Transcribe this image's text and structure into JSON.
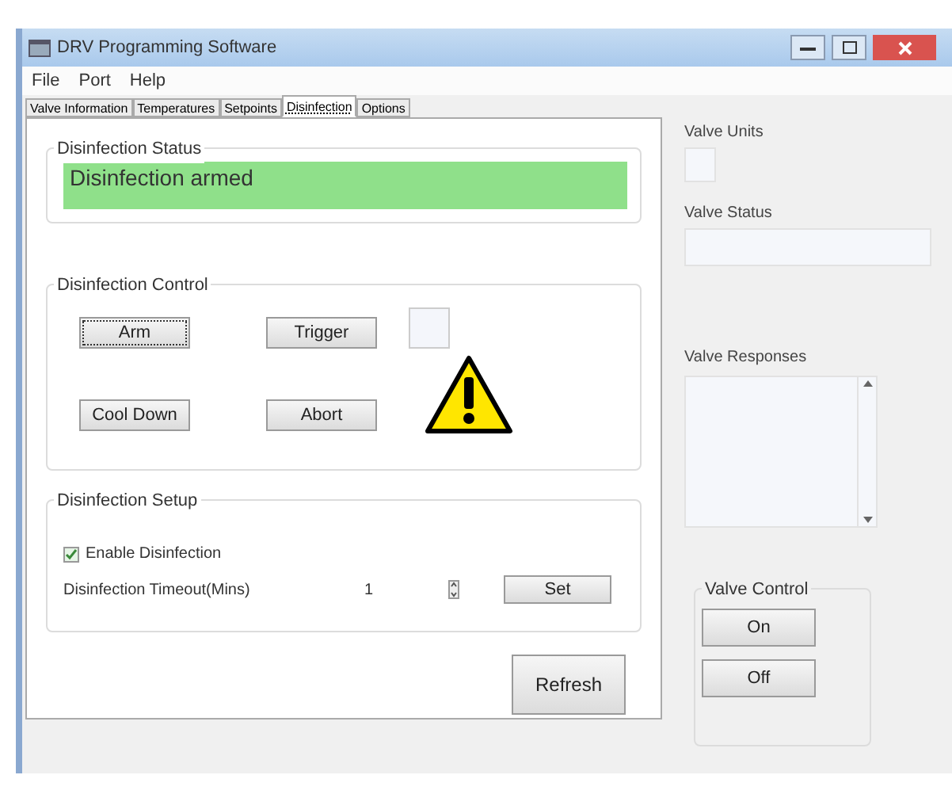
{
  "window": {
    "title": "DRV Programming Software"
  },
  "menu": [
    "File",
    "Port",
    "Help"
  ],
  "tabs": [
    {
      "label": "Valve Information",
      "selected": false
    },
    {
      "label": "Temperatures",
      "selected": false
    },
    {
      "label": "Setpoints",
      "selected": false
    },
    {
      "label": "Disinfection",
      "selected": true
    },
    {
      "label": "Options",
      "selected": false
    }
  ],
  "status_group": {
    "title": "Disinfection Status",
    "message": "Disinfection armed",
    "color": "#8fe08a"
  },
  "control_group": {
    "title": "Disinfection Control",
    "buttons": [
      {
        "label": "Arm",
        "focused": true
      },
      {
        "label": "Trigger",
        "focused": false
      },
      {
        "label": "Cool Down",
        "focused": false
      },
      {
        "label": "Abort",
        "focused": false
      }
    ],
    "warning": true
  },
  "setup_group": {
    "title": "Disinfection Setup",
    "enable": {
      "label": "Enable Disinfection",
      "checked": true
    },
    "timeout_label": "Disinfection Timeout(Mins)",
    "timeout_value": "1",
    "set_button": "Set"
  },
  "refresh_button": "Refresh",
  "side": {
    "units_label": "Valve Units",
    "status_label": "Valve Status",
    "responses_label": "Valve Responses",
    "control_group": {
      "title": "Valve Control",
      "buttons": [
        "On",
        "Off"
      ]
    }
  }
}
